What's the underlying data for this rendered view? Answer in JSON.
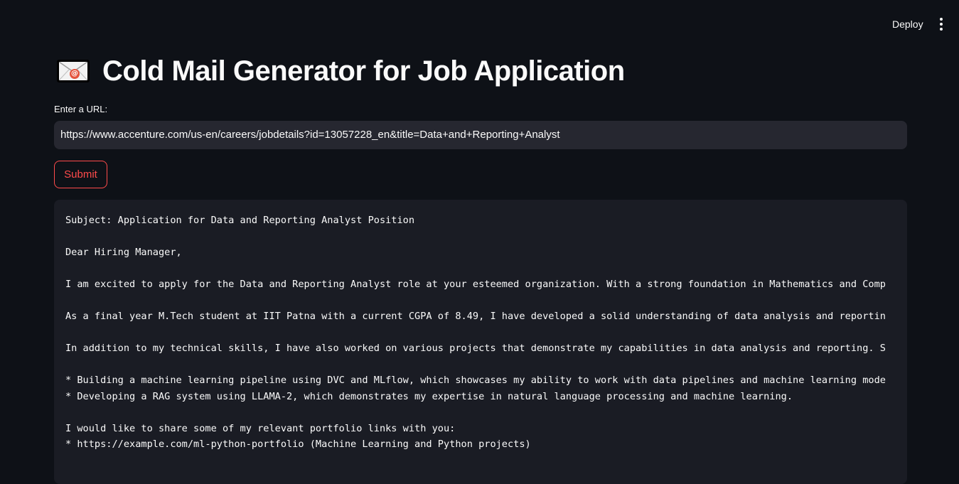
{
  "header": {
    "deploy_label": "Deploy",
    "menu_icon": "more-vertical-icon"
  },
  "page": {
    "title_icon": "envelope-icon",
    "title": "Cold Mail Generator for Job Application"
  },
  "form": {
    "url_label": "Enter a URL:",
    "url_value": "https://www.accenture.com/us-en/careers/jobdetails?id=13057228_en&title=Data+and+Reporting+Analyst",
    "submit_label": "Submit"
  },
  "output": {
    "lines": [
      "Subject: Application for Data and Reporting Analyst Position",
      "",
      "Dear Hiring Manager,",
      "",
      "I am excited to apply for the Data and Reporting Analyst role at your esteemed organization. With a strong foundation in Mathematics and Comp",
      "",
      "As a final year M.Tech student at IIT Patna with a current CGPA of 8.49, I have developed a solid understanding of data analysis and reportin",
      "",
      "In addition to my technical skills, I have also worked on various projects that demonstrate my capabilities in data analysis and reporting. S",
      "",
      "* Building a machine learning pipeline using DVC and MLflow, which showcases my ability to work with data pipelines and machine learning mode",
      "* Developing a RAG system using LLAMA-2, which demonstrates my expertise in natural language processing and machine learning.",
      "",
      "I would like to share some of my relevant portfolio links with you:",
      "* https://example.com/ml-python-portfolio (Machine Learning and Python projects)"
    ]
  },
  "colors": {
    "background": "#0e1117",
    "input_bg": "#262730",
    "code_bg": "#1a1c24",
    "accent": "#ff4b4b",
    "text": "#fafafa"
  }
}
